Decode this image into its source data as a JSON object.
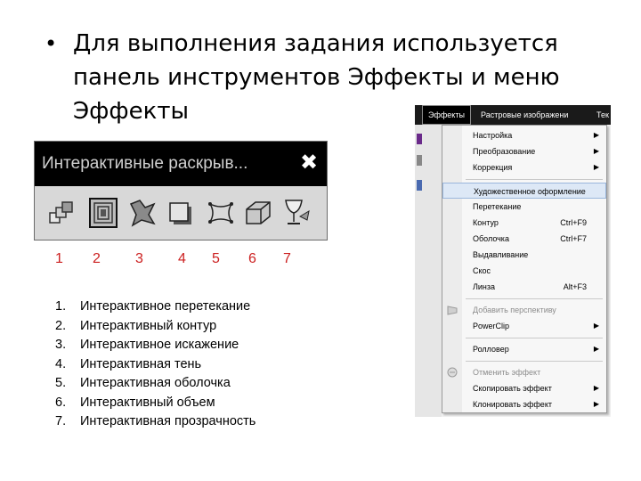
{
  "slide": {
    "bullet": "•",
    "heading": "Для выполнения задания используется панель инструментов Эффекты и меню Эффекты"
  },
  "toolbar": {
    "title": "Интерактивные раскрыв...",
    "close_glyph": "✖",
    "tools": [
      {
        "icon": "interactive-blend-icon"
      },
      {
        "icon": "interactive-contour-icon"
      },
      {
        "icon": "interactive-distortion-icon"
      },
      {
        "icon": "interactive-drop-shadow-icon"
      },
      {
        "icon": "interactive-envelope-icon"
      },
      {
        "icon": "interactive-extrude-icon"
      },
      {
        "icon": "interactive-transparency-icon"
      }
    ]
  },
  "numbers": [
    "1",
    "2",
    "3",
    "4",
    "5",
    "6",
    "7"
  ],
  "list": [
    {
      "n": "1.",
      "text": "Интерактивное перетекание"
    },
    {
      "n": "2.",
      "text": "Интерактивный контур"
    },
    {
      "n": "3.",
      "text": "Интерактивное искажение"
    },
    {
      "n": "4.",
      "text": "Интерактивная тень"
    },
    {
      "n": "5.",
      "text": "Интерактивная оболочка"
    },
    {
      "n": "6.",
      "text": "Интерактивный объем"
    },
    {
      "n": "7.",
      "text": "Интерактивная прозрачность"
    }
  ],
  "menu": {
    "bar": [
      "Эффекты",
      "Растровые изображени",
      "Тек"
    ],
    "items": [
      {
        "label": "Настройка",
        "shortcut": "",
        "submenu": true,
        "disabled": false
      },
      {
        "label": "Преобразование",
        "shortcut": "",
        "submenu": true,
        "disabled": false
      },
      {
        "label": "Коррекция",
        "shortcut": "",
        "submenu": true,
        "disabled": false
      },
      {
        "label": "Художественное оформление",
        "shortcut": "",
        "submenu": false,
        "disabled": false
      },
      {
        "label": "Перетекание",
        "shortcut": "",
        "submenu": false,
        "disabled": false
      },
      {
        "label": "Контур",
        "shortcut": "Ctrl+F9",
        "submenu": false,
        "disabled": false
      },
      {
        "label": "Оболочка",
        "shortcut": "Ctrl+F7",
        "submenu": false,
        "disabled": false
      },
      {
        "label": "Выдавливание",
        "shortcut": "",
        "submenu": false,
        "disabled": false
      },
      {
        "label": "Скос",
        "shortcut": "",
        "submenu": false,
        "disabled": false
      },
      {
        "label": "Линза",
        "shortcut": "Alt+F3",
        "submenu": false,
        "disabled": false
      },
      {
        "label": "Добавить перспективу",
        "shortcut": "",
        "submenu": false,
        "disabled": true
      },
      {
        "label": "PowerClip",
        "shortcut": "",
        "submenu": true,
        "disabled": false
      },
      {
        "label": "Ролловер",
        "shortcut": "",
        "submenu": true,
        "disabled": false
      },
      {
        "label": "Отменить эффект",
        "shortcut": "",
        "submenu": false,
        "disabled": true
      },
      {
        "label": "Скопировать эффект",
        "shortcut": "",
        "submenu": true,
        "disabled": false
      },
      {
        "label": "Клонировать эффект",
        "shortcut": "",
        "submenu": true,
        "disabled": false
      }
    ],
    "submenu_arrow": "▶"
  },
  "colors": {
    "number_red": "#cc2020",
    "toolbar_title_bg": "#000000",
    "menu_highlight": "#dde8f6"
  }
}
